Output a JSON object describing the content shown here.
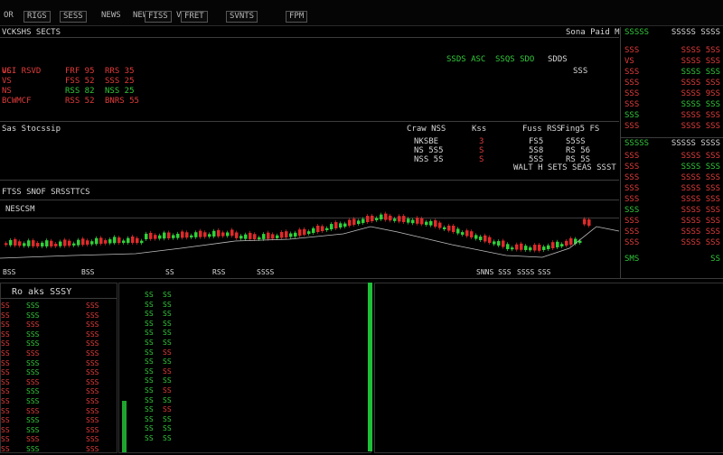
{
  "toolbar": {
    "items": [
      "OR",
      "RIGS",
      "SESS",
      "NEWS",
      "NEWS",
      "ON",
      "VEW",
      "FISS",
      "FRET",
      "SVNTS",
      "FPM"
    ],
    "accent": "#1e8a3c"
  },
  "top_panel": {
    "title": "VCKSHS SECTS",
    "right_label": "Sona Paid M",
    "sub_label": "UCI RSVD",
    "price_header": [
      "SSDS ASC",
      "SSQS SDO",
      "SDDS"
    ],
    "price_val": "SSS",
    "bids": [
      {
        "a": "VS",
        "b": "FRF 95",
        "c": "RRS 35",
        "status": "r"
      },
      {
        "a": "VS",
        "b": "FSS 52",
        "c": "SSS 25",
        "status": "r"
      },
      {
        "a": "NS",
        "b": "RSS 82",
        "c": "NSS 25",
        "status": "g"
      },
      {
        "a": "BCWMCF",
        "b": "RSS 52",
        "c": "BNRS 55",
        "status": "r"
      }
    ]
  },
  "mid_panel": {
    "title": "Sas Stocssip",
    "header": [
      "Craw NSS",
      "Kss",
      "Fuss RSS",
      "Fing5 FS"
    ],
    "rows": [
      [
        "NKSBE",
        "3",
        "FS5",
        "S5SS"
      ],
      [
        "NS 5S5",
        "S",
        "5S8",
        "RS 56"
      ],
      [
        "NSS 5S",
        "S",
        "5SS",
        "RS 5S"
      ]
    ],
    "footer": "WALT H SETS SEAS SSST"
  },
  "chart": {
    "title": "FTSS SNOF SRSSTTCS",
    "legend": "NESCSM",
    "ticks": [
      "BSS",
      "BSS",
      "SS",
      "RSS",
      "SSSS",
      "SNNS SSS",
      "SSSS",
      "SSS"
    ],
    "up_color": "#2fd13a",
    "down_color": "#e02a2a"
  },
  "right_panel": {
    "header": [
      "SSSSS",
      "SSSSS SSSS"
    ],
    "rows_a": [
      {
        "l": "SSS",
        "r": "SSSS 5SS",
        "lc": "r",
        "rc": "r"
      },
      {
        "l": "VS",
        "r": "SSSS SSS",
        "lc": "r",
        "rc": "r"
      },
      {
        "l": "SSS",
        "r": "SSSS SSS",
        "lc": "r",
        "rc": "g"
      },
      {
        "l": "SSS",
        "r": "SSSS SSS",
        "lc": "r",
        "rc": "r"
      },
      {
        "l": "SSS",
        "r": "SSSS 9SS",
        "lc": "r",
        "rc": "r"
      },
      {
        "l": "SSS",
        "r": "SSSS SSS",
        "lc": "r",
        "rc": "g"
      },
      {
        "l": "SSS",
        "r": "SSSS SSS",
        "lc": "g",
        "rc": "r"
      },
      {
        "l": "SSS",
        "r": "SSSS SSS",
        "lc": "r",
        "rc": "r"
      }
    ],
    "header2": [
      "SSSSS",
      "SSSSS SSSS"
    ],
    "rows_b": [
      {
        "l": "SSS",
        "r": "SSSS SSS",
        "lc": "r",
        "rc": "r"
      },
      {
        "l": "SSS",
        "r": "SSSS SSS",
        "lc": "r",
        "rc": "g"
      },
      {
        "l": "SSS",
        "r": "SSSS SSS",
        "lc": "r",
        "rc": "r"
      },
      {
        "l": "SSS",
        "r": "SSSS SSS",
        "lc": "r",
        "rc": "r"
      },
      {
        "l": "SSS",
        "r": "SSSS SSS",
        "lc": "r",
        "rc": "r"
      },
      {
        "l": "SSS",
        "r": "SSSS SSS",
        "lc": "g",
        "rc": "r"
      },
      {
        "l": "SSS",
        "r": "SSSS SSS",
        "lc": "r",
        "rc": "r"
      },
      {
        "l": "SSS",
        "r": "SSSS SSS",
        "lc": "r",
        "rc": "r"
      },
      {
        "l": "SSS",
        "r": "SSSS SSS",
        "lc": "r",
        "rc": "r"
      }
    ],
    "footer": [
      "SMS",
      "SS"
    ]
  },
  "bottom_left": {
    "title": "Ro aks SSSY",
    "col1": [
      "SS",
      "SS",
      "SS",
      "SS",
      "SS",
      "SS",
      "SS",
      "SS",
      "SS",
      "SS",
      "SS",
      "SS",
      "SS",
      "SS",
      "SS",
      "SS"
    ],
    "col2": [
      "SSS",
      "SSS",
      "SSS",
      "SSS",
      "SSS",
      "SSS",
      "SSS",
      "SSS",
      "SSS",
      "SSS",
      "SSS",
      "SSS",
      "SSS",
      "SSS",
      "SSS",
      "SSS"
    ],
    "col3": [
      "SSS",
      "SSS",
      "SSS",
      "SSS",
      "SSS",
      "SSS",
      "SSS",
      "SSS",
      "SSS",
      "SSS",
      "SSS",
      "SSS",
      "SSS",
      "SSS",
      "SSS",
      "SSS"
    ]
  },
  "bottom_mid": {
    "col1": [
      "SS",
      "SS",
      "SS",
      "SS",
      "SS",
      "SS",
      "SS",
      "SS",
      "SS",
      "SS",
      "SS",
      "SS",
      "SS",
      "SS",
      "SS",
      "SS"
    ],
    "col2": [
      "SS",
      "SS",
      "SS",
      "SS",
      "SS",
      "SS",
      "SS",
      "SS",
      "SS",
      "SS",
      "SS",
      "SS",
      "SS",
      "SS",
      "SS",
      "SS"
    ]
  }
}
